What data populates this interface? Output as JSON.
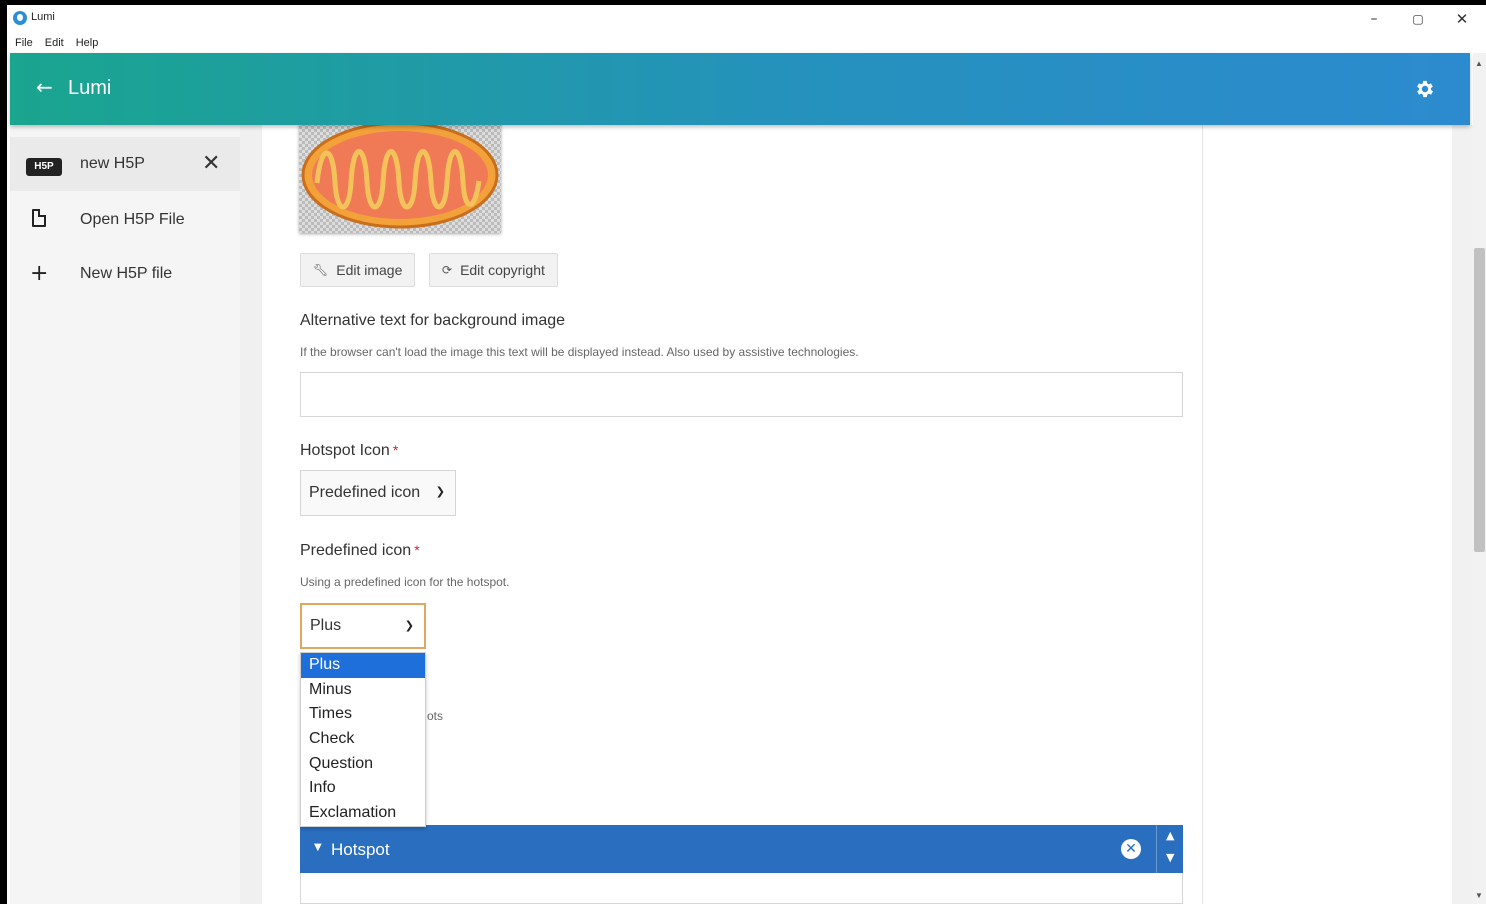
{
  "window": {
    "title": "Lumi",
    "controls": {
      "minimize": "–",
      "maximize": "▢",
      "close": "✕"
    }
  },
  "menubar": {
    "items": [
      "File",
      "Edit",
      "Help"
    ]
  },
  "header": {
    "title": "Lumi",
    "back_icon": "arrow-left-icon",
    "settings_icon": "gear-icon"
  },
  "sidebar": {
    "items": [
      {
        "badge": "H5P",
        "label": "new H5P",
        "active": true,
        "icon": "h5p-badge-icon"
      },
      {
        "label": "Open H5P File",
        "icon": "file-icon"
      },
      {
        "label": "New H5P file",
        "icon": "plus-icon"
      }
    ]
  },
  "editor": {
    "edit_image_label": "Edit image",
    "edit_copyright_label": "Edit copyright",
    "alt_text": {
      "label": "Alternative text for background image",
      "description": "If the browser can't load the image this text will be displayed instead. Also used by assistive technologies.",
      "value": ""
    },
    "hotspot_icon": {
      "label": "Hotspot Icon",
      "required_mark": "*",
      "selected": "Predefined icon"
    },
    "predefined_icon": {
      "label": "Predefined icon",
      "required_mark": "*",
      "description": "Using a predefined icon for the hotspot.",
      "selected": "Plus",
      "options": [
        "Plus",
        "Minus",
        "Times",
        "Check",
        "Question",
        "Info",
        "Exclamation"
      ]
    },
    "partially_hidden_text": "ots",
    "hotspot_group": {
      "title": "Hotspot"
    }
  },
  "colors": {
    "header_gradient_start": "#1aa58f",
    "header_gradient_end": "#2c8bcf",
    "hotspot_bar": "#2a6ebf",
    "dropdown_selected": "#1e6fd9",
    "focus_border": "#e0a75e",
    "required": "#d21f28"
  }
}
